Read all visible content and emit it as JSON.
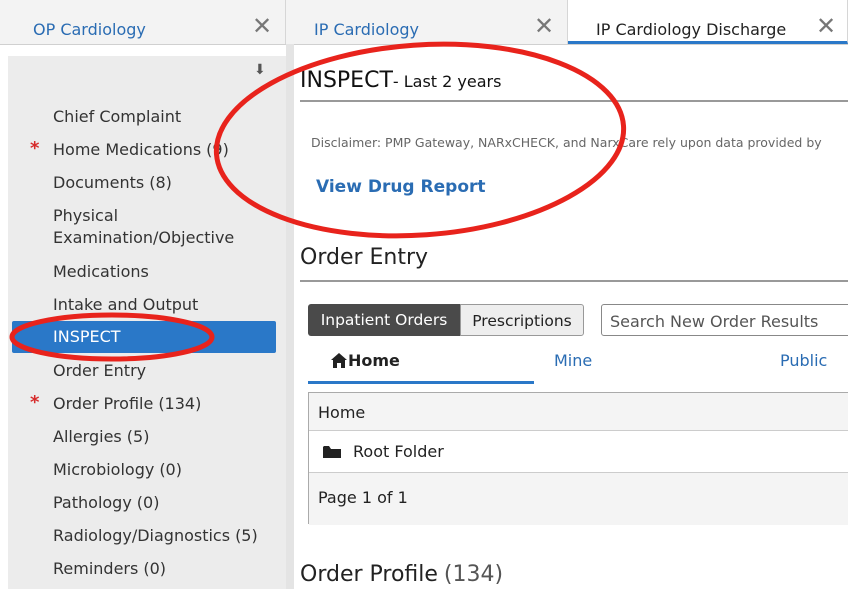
{
  "tabs": [
    {
      "label": "OP Cardiology"
    },
    {
      "label": "IP Cardiology"
    },
    {
      "label": "IP Cardiology Discharge"
    }
  ],
  "sidebar": {
    "pin_icon": "pin-icon",
    "items": [
      {
        "label": "Chief Complaint",
        "count": "",
        "required": false
      },
      {
        "label": "Home Medications",
        "count": "(9)",
        "required": true
      },
      {
        "label": "Documents",
        "count": "(8)",
        "required": false
      },
      {
        "label": "Physical Examination/Objective",
        "count": "",
        "required": false
      },
      {
        "label": "Medications",
        "count": "",
        "required": false
      },
      {
        "label": "Intake and Output",
        "count": "",
        "required": false
      },
      {
        "label": "INSPECT",
        "count": "",
        "required": false,
        "selected": true
      },
      {
        "label": "Order Entry",
        "count": "",
        "required": false
      },
      {
        "label": "Order Profile",
        "count": "(134)",
        "required": true
      },
      {
        "label": "Allergies",
        "count": "(5)",
        "required": false
      },
      {
        "label": "Microbiology",
        "count": "(0)",
        "required": false
      },
      {
        "label": "Pathology",
        "count": "(0)",
        "required": false
      },
      {
        "label": "Radiology/Diagnostics",
        "count": "(5)",
        "required": false
      },
      {
        "label": "Reminders",
        "count": "(0)",
        "required": false
      }
    ],
    "physical_line1": "Physical",
    "physical_line2": "Examination/Objective"
  },
  "inspect": {
    "title": "INSPECT",
    "subtitle": "- Last 2 years",
    "disclaimer": "Disclaimer: PMP Gateway, NARxCHECK, and NarxCare rely upon data provided by",
    "link": "View Drug Report"
  },
  "order_entry": {
    "title": "Order Entry",
    "segments": [
      "Inpatient Orders",
      "Prescriptions"
    ],
    "search_placeholder": "Search New Order Results",
    "subtabs": [
      "Home",
      "Mine",
      "Public"
    ],
    "grid": {
      "header": "Home",
      "folder": "Root Folder",
      "pager": "Page 1 of 1"
    }
  },
  "order_profile": {
    "title": "Order Profile",
    "count": "(134)"
  },
  "colors": {
    "accent": "#2a78c8",
    "link": "#2a6cb3",
    "required": "#d62b2b",
    "annotation": "#e8231c"
  }
}
